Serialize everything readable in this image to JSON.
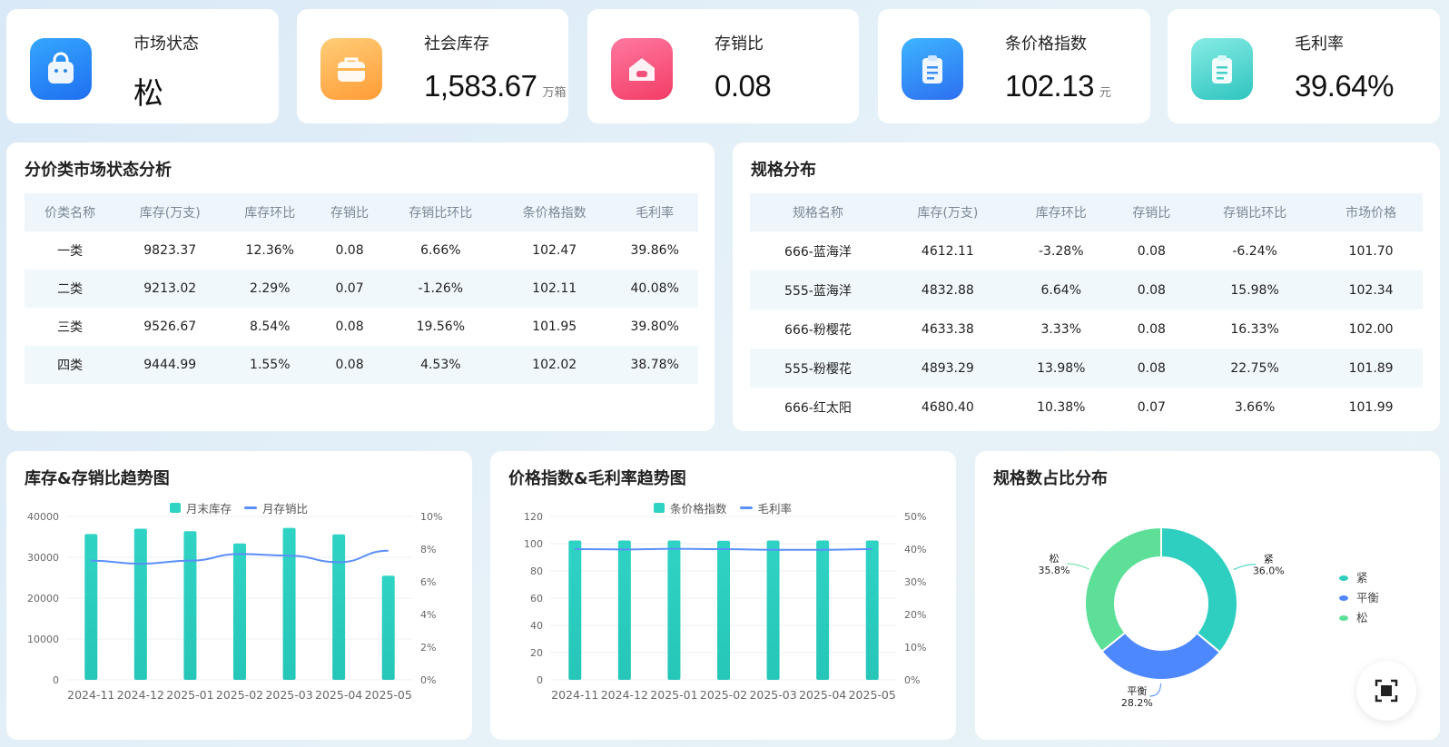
{
  "kpis": [
    {
      "label": "市场状态",
      "value": "松",
      "unit": "",
      "icon": "shopping-bag-icon",
      "gradient": [
        "#2f9bff",
        "#1f6ff0"
      ]
    },
    {
      "label": "社会库存",
      "value": "1,583.67",
      "unit": "万箱",
      "icon": "briefcase-icon",
      "gradient": [
        "#ffc56a",
        "#ff9f3a"
      ]
    },
    {
      "label": "存销比",
      "value": "0.08",
      "unit": "",
      "icon": "home-icon",
      "gradient": [
        "#ff6f98",
        "#f23d6a"
      ]
    },
    {
      "label": "条价格指数",
      "value": "102.13",
      "unit": "元",
      "icon": "clipboard-icon",
      "gradient": [
        "#3aaeff",
        "#2d73f0"
      ]
    },
    {
      "label": "毛利率",
      "value": "39.64%",
      "unit": "",
      "icon": "clipboard-icon",
      "gradient": [
        "#7ee6e0",
        "#35c7c4"
      ]
    }
  ],
  "category_table": {
    "title": "分价类市场状态分析",
    "headers": [
      "价类名称",
      "库存(万支)",
      "库存环比",
      "存销比",
      "存销比环比",
      "条价格指数",
      "毛利率"
    ],
    "rows": [
      [
        "一类",
        "9823.37",
        "12.36%",
        "0.08",
        "6.66%",
        "102.47",
        "39.86%"
      ],
      [
        "二类",
        "9213.02",
        "2.29%",
        "0.07",
        "-1.26%",
        "102.11",
        "40.08%"
      ],
      [
        "三类",
        "9526.67",
        "8.54%",
        "0.08",
        "19.56%",
        "101.95",
        "39.80%"
      ],
      [
        "四类",
        "9444.99",
        "1.55%",
        "0.08",
        "4.53%",
        "102.02",
        "38.78%"
      ]
    ]
  },
  "spec_table": {
    "title": "规格分布",
    "headers": [
      "规格名称",
      "库存(万支)",
      "库存环比",
      "存销比",
      "存销比环比",
      "市场价格"
    ],
    "rows": [
      [
        "666-蓝海洋",
        "4612.11",
        "-3.28%",
        "0.08",
        "-6.24%",
        "101.70"
      ],
      [
        "555-蓝海洋",
        "4832.88",
        "6.64%",
        "0.08",
        "15.98%",
        "102.34"
      ],
      [
        "666-粉樱花",
        "4633.38",
        "3.33%",
        "0.08",
        "16.33%",
        "102.00"
      ],
      [
        "555-粉樱花",
        "4893.29",
        "13.98%",
        "0.08",
        "22.75%",
        "101.89"
      ],
      [
        "666-红太阳",
        "4680.40",
        "10.38%",
        "0.07",
        "3.66%",
        "101.99"
      ]
    ]
  },
  "charts": {
    "inventory": {
      "title": "库存&存销比趋势图",
      "legend_bar": "月末库存",
      "legend_line": "月存销比"
    },
    "price": {
      "title": "价格指数&毛利率趋势图",
      "legend_bar": "条价格指数",
      "legend_line": "毛利率"
    },
    "pie": {
      "title": "规格数占比分布"
    }
  },
  "colors": {
    "bar_top": "#2fd3c4",
    "bar_bottom": "#26c6b8",
    "line": "#5b8ff9",
    "tight": "#2ecfc0",
    "balance": "#4d88ff",
    "loose": "#5ddf98"
  },
  "chart_data": [
    {
      "type": "bar",
      "categories": [
        "2024-11",
        "2024-12",
        "2025-01",
        "2025-02",
        "2025-03",
        "2025-04",
        "2025-05"
      ],
      "series": [
        {
          "name": "月末库存",
          "type": "bar",
          "axis": "left",
          "values": [
            35700,
            37000,
            36400,
            33400,
            37200,
            35600,
            25500
          ]
        },
        {
          "name": "月存销比",
          "type": "line",
          "axis": "right",
          "values": [
            7.3,
            7.1,
            7.3,
            7.7,
            7.6,
            7.2,
            7.9
          ]
        }
      ],
      "ylim": [
        0,
        40000
      ],
      "y_ticks": [
        "0",
        "10000",
        "20000",
        "30000",
        "40000"
      ],
      "y2lim": [
        0,
        10
      ],
      "y2_ticks": [
        "0%",
        "2%",
        "4%",
        "6%",
        "8%",
        "10%"
      ],
      "legend_position": "top-center"
    },
    {
      "type": "bar",
      "categories": [
        "2024-11",
        "2024-12",
        "2025-01",
        "2025-02",
        "2025-03",
        "2025-04",
        "2025-05"
      ],
      "series": [
        {
          "name": "条价格指数",
          "type": "bar",
          "axis": "left",
          "values": [
            102.3,
            102.3,
            102.3,
            102.2,
            102.3,
            102.3,
            102.3
          ]
        },
        {
          "name": "毛利率",
          "type": "line",
          "axis": "right",
          "values": [
            40.0,
            39.9,
            40.1,
            40.0,
            39.8,
            39.8,
            40.0
          ]
        }
      ],
      "ylim": [
        0,
        120
      ],
      "y_ticks": [
        "0",
        "20",
        "40",
        "60",
        "80",
        "100",
        "120"
      ],
      "y2lim": [
        0,
        50
      ],
      "y2_ticks": [
        "0%",
        "10%",
        "20%",
        "30%",
        "40%",
        "50%"
      ],
      "legend_position": "top-center"
    },
    {
      "type": "pie",
      "donut": true,
      "slices": [
        {
          "name": "紧",
          "value": 36.0,
          "label": "紧",
          "pct": "36.0%"
        },
        {
          "name": "平衡",
          "value": 28.2,
          "label": "平衡",
          "pct": "28.2%"
        },
        {
          "name": "松",
          "value": 35.8,
          "label": "松",
          "pct": "35.8%"
        }
      ],
      "legend_position": "right"
    }
  ]
}
